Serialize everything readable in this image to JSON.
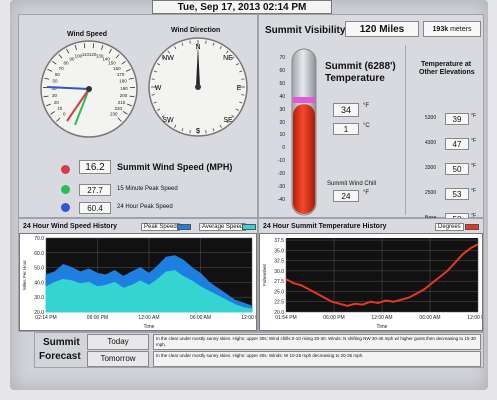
{
  "header": {
    "datetime": "Tue, Sep 17, 2013   02:14 PM"
  },
  "wind": {
    "speed_title": "Wind Speed",
    "direction_title": "Wind Direction",
    "speed_label": "Summit Wind Speed (MPH)",
    "speed_value": "16.2",
    "peak15_label": "15 Minute Peak Speed",
    "peak15_value": "27.7",
    "peak24_label": "24 Hour Peak Speed",
    "peak24_value": "60.4",
    "compass": {
      "n": "N",
      "ne": "NE",
      "e": "E",
      "se": "SE",
      "s": "S",
      "sw": "SW",
      "w": "W",
      "nw": "NW"
    },
    "direction_degrees": 0,
    "speed_ticks": [
      "0",
      "10",
      "20",
      "30",
      "40",
      "50",
      "60",
      "70",
      "80",
      "90",
      "100",
      "110",
      "120",
      "130",
      "140",
      "150",
      "160",
      "170",
      "180",
      "190",
      "200",
      "210",
      "220",
      "230"
    ],
    "dot_colors": {
      "current": "#d83a4a",
      "peak15": "#2dbb57",
      "peak24": "#2f55d0"
    }
  },
  "visibility": {
    "title": "Summit Visibility",
    "value": "120 Miles",
    "meters": "193k",
    "meters_unit": "meters"
  },
  "temperature": {
    "title_line1": "Summit (6288')",
    "title_line2": "Temperature",
    "f_value": "34",
    "f_unit": "°F",
    "c_value": "1",
    "c_unit": "°C",
    "windchill_label": "Summit Wind Chill",
    "windchill_value": "24",
    "windchill_unit": "°F",
    "thermo_ticks": [
      "70",
      "60",
      "50",
      "40",
      "30",
      "20",
      "10",
      "0",
      "-10",
      "-20",
      "-30",
      "-40"
    ],
    "elev_title_1": "Temperature at",
    "elev_title_2": "Other Elevations",
    "elevations": [
      {
        "label": "5300",
        "value": "39",
        "unit": "°F"
      },
      {
        "label": "4300",
        "value": "47",
        "unit": "°F"
      },
      {
        "label": "3300",
        "value": "50",
        "unit": "°F"
      },
      {
        "label": "2500",
        "value": "53",
        "unit": "°F"
      },
      {
        "label": "Base",
        "value": "58",
        "unit": "°F"
      }
    ]
  },
  "wind_history": {
    "title": "24 Hour Wind Speed History",
    "legend_peak": "Peak Speed",
    "legend_avg": "Average Speed",
    "ylabel": "Miles Per Hour",
    "xlabel": "Time",
    "xticks": [
      "02:14 PM",
      "06:00 PM",
      "12:00 AM",
      "06:00 AM",
      "12:00 PM"
    ],
    "yticks": [
      "70.0",
      "60.0",
      "50.0",
      "40.0",
      "30.0",
      "20.0"
    ]
  },
  "temp_history": {
    "title": "24 Hour Summit Temperature History",
    "legend": "Degrees",
    "ylabel": "Fahrenheit",
    "xlabel": "Time",
    "xticks": [
      "01:54 PM",
      "06:00 PM",
      "12:00 AM",
      "06:00 AM",
      "12:00 PM"
    ],
    "yticks": [
      "37.5",
      "35.0",
      "32.5",
      "30.0",
      "27.5",
      "25.0",
      "22.5",
      "20.0"
    ]
  },
  "forecast": {
    "label1": "Summit",
    "label2": "Forecast",
    "today_button": "Today",
    "tomorrow_button": "Tomorrow",
    "today_text": "In the clear under mostly sunny skies.   Highs: upper 30s; Wind chills 0-10 rising 20-30.   Winds: N shifting NW 30-45 mph w/ higher gusts then decreasing to 15-30 mph.",
    "tomorrow_text": "In the clear under mostly sunny skies.   Highs: upper 40s.   Winds: W 10-25 mph decreasing to 20-35 mph."
  },
  "chart_data": [
    {
      "type": "area",
      "title": "24 Hour Wind Speed History",
      "ylabel": "Miles Per Hour",
      "xlabel": "Time",
      "x": [
        "02:14 PM",
        "06:00 PM",
        "12:00 AM",
        "06:00 AM",
        "12:00 PM"
      ],
      "ylim": [
        20,
        70
      ],
      "series": [
        {
          "name": "Peak Speed",
          "color": "#1f7fe0",
          "values": [
            45,
            47,
            52,
            50,
            47,
            49,
            46,
            45,
            48,
            44,
            47,
            50,
            46,
            51,
            57,
            58,
            55,
            50,
            46,
            40,
            36,
            32,
            28,
            26,
            24
          ]
        },
        {
          "name": "Average Speed",
          "color": "#35d4d1",
          "values": [
            37,
            40,
            42,
            41,
            39,
            40,
            37,
            38,
            40,
            36,
            38,
            41,
            38,
            42,
            47,
            48,
            44,
            41,
            37,
            34,
            31,
            28,
            25,
            23,
            22
          ]
        }
      ]
    },
    {
      "type": "line",
      "title": "24 Hour Summit Temperature History",
      "ylabel": "Fahrenheit",
      "xlabel": "Time",
      "x": [
        "01:54 PM",
        "06:00 PM",
        "12:00 AM",
        "06:00 AM",
        "12:00 PM"
      ],
      "ylim": [
        20,
        38
      ],
      "series": [
        {
          "name": "Degrees",
          "color": "#e53821",
          "values": [
            28,
            27,
            26.5,
            25.5,
            24.5,
            23.5,
            22.5,
            22,
            21.5,
            22,
            21.8,
            22.5,
            22.2,
            22.8,
            22.5,
            23,
            23.5,
            24.5,
            25.5,
            27,
            28.5,
            30,
            32,
            34,
            35.5,
            36.5
          ]
        }
      ]
    }
  ]
}
